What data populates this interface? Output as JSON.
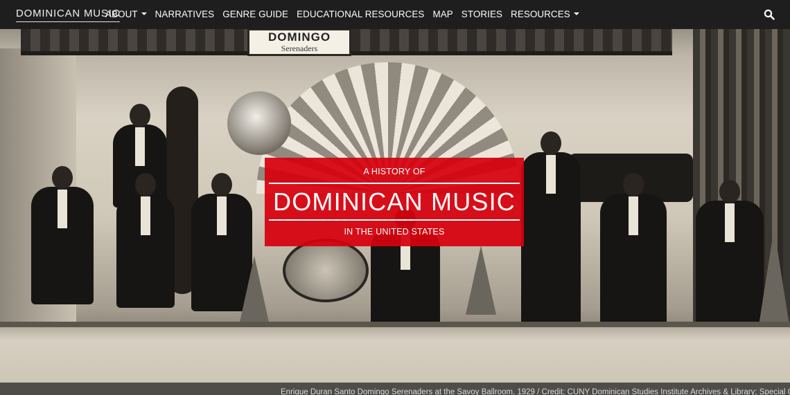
{
  "navbar": {
    "brand": "DOMINICAN MUSIC",
    "items": [
      {
        "label": "ABOUT",
        "dropdown": true
      },
      {
        "label": "NARRATIVES",
        "dropdown": false
      },
      {
        "label": "GENRE GUIDE",
        "dropdown": false
      },
      {
        "label": "EDUCATIONAL RESOURCES",
        "dropdown": false
      },
      {
        "label": "MAP",
        "dropdown": false
      },
      {
        "label": "STORIES",
        "dropdown": false
      },
      {
        "label": "RESOURCES",
        "dropdown": true
      }
    ],
    "search_icon": "search-icon"
  },
  "hero": {
    "sign_line1": "DOMINGO",
    "sign_line2": "Serenaders",
    "title_top": "A HISTORY OF",
    "title_main": "DOMINICAN MUSIC",
    "title_bottom": "IN THE UNITED STATES",
    "caption": "Enrique Duran Santo Domingo Serenaders at the Savoy Ballroom, 1929 / Credit: CUNY Dominican Studies Institute Archives & Library; Special Collections"
  },
  "colors": {
    "navbar_bg": "#1e1e1e",
    "title_box_bg": "#d6000e",
    "text_light": "#ffffff"
  }
}
